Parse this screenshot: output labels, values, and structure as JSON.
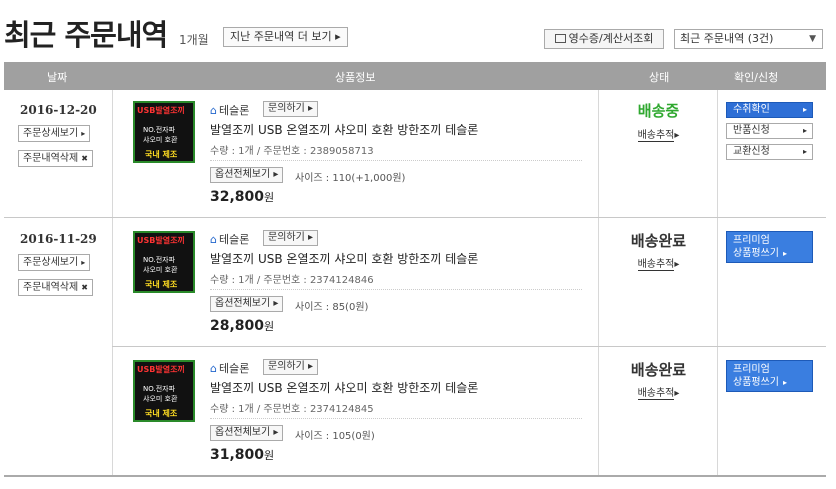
{
  "header": {
    "title": "최근 주문내역",
    "period": "1개월",
    "past_orders_button": "지난 주문내역 더 보기",
    "receipt_button": "영수증/계산서조회",
    "filter_selected": "최근 주문내역 (3건)"
  },
  "columns": {
    "date": "날짜",
    "product": "상품정보",
    "status": "상태",
    "confirm": "확인/신청"
  },
  "labels": {
    "detail_button": "주문상세보기",
    "delete_button": "주문내역삭제",
    "inquiry_button": "문의하기",
    "options_button": "옵션전체보기",
    "track_link": "배송추적",
    "receive_confirm": "수취확인",
    "return_request": "반품신청",
    "exchange_request": "교환신청",
    "premium_review_1": "프리미엄",
    "premium_review_2": "상품평쓰기"
  },
  "thumb_text": {
    "line1": "USB발열조끼",
    "line2": "NO.전자파",
    "line3": "샤오미 호환",
    "line4": "국내 제조"
  },
  "orders": [
    {
      "date": "2016-12-20",
      "seller": "테슬론",
      "product_name": "발열조끼 USB 온열조끼 샤오미 호환 방한조끼 테슬론",
      "meta": "수량 : 1개 / 주문번호 : 2389058713",
      "size": "사이즈 : 110(+1,000원)",
      "price": "32,800",
      "currency": "원",
      "status": "배송중",
      "status_color": "#2fa82f"
    },
    {
      "date": "2016-11-29",
      "seller": "테슬론",
      "product_name": "발열조끼 USB 온열조끼 샤오미 호환 방한조끼 테슬론",
      "meta": "수량 : 1개 / 주문번호 : 2374124846",
      "size": "사이즈 : 85(0원)",
      "price": "28,800",
      "currency": "원",
      "status": "배송완료",
      "status_color": "#333333"
    },
    {
      "seller": "테슬론",
      "product_name": "발열조끼 USB 온열조끼 샤오미 호환 방한조끼 테슬론",
      "meta": "수량 : 1개 / 주문번호 : 2374124845",
      "size": "사이즈 : 105(0원)",
      "price": "31,800",
      "currency": "원",
      "status": "배송완료",
      "status_color": "#333333"
    }
  ]
}
